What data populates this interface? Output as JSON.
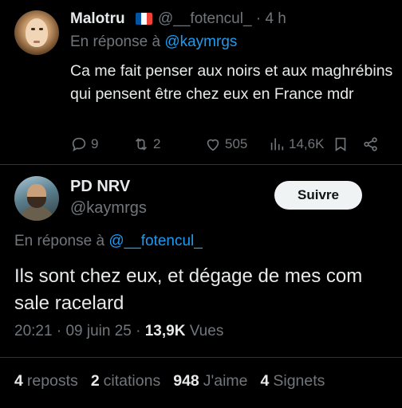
{
  "tweet1": {
    "display_name": "Malotru",
    "flag_icon": "france-flag-icon",
    "flag_colors": [
      "#0055a4",
      "#ffffff",
      "#ef4135"
    ],
    "handle": "@__fotencul_",
    "separator": "·",
    "time": "4 h",
    "reply_prefix": "En réponse à",
    "reply_to": "@kaymrgs",
    "text": "Ca me fait penser aux noirs et aux maghrébins qui pensent être chez eux en France mdr",
    "actions": {
      "replies": "9",
      "reposts": "2",
      "likes": "505",
      "views": "14,6K"
    }
  },
  "tweet2": {
    "display_name": "PD NRV",
    "handle": "@kaymrgs",
    "follow_label": "Suivre",
    "reply_prefix": "En réponse à",
    "reply_to": "@__fotencul_",
    "text": "Ils sont chez eux, et dégage de mes com sale racelard",
    "time": "20:21",
    "date": "09 juin 25",
    "dot": "·",
    "views": "13,9K",
    "views_label": "Vues",
    "stats": {
      "reposts_num": "4",
      "reposts_label": "reposts",
      "quotes_num": "2",
      "quotes_label": "citations",
      "likes_num": "948",
      "likes_label": "J'aime",
      "bookmarks_num": "4",
      "bookmarks_label": "Signets"
    }
  },
  "colors": {
    "background": "#000000",
    "text": "#e7e9ea",
    "muted": "#71767b",
    "link": "#1d9bf0",
    "divider": "#2f3336"
  }
}
